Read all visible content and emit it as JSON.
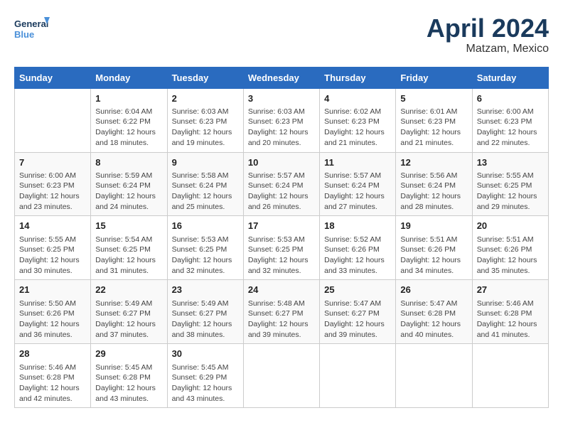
{
  "header": {
    "logo_line1": "General",
    "logo_line2": "Blue",
    "month_year": "April 2024",
    "location": "Matzam, Mexico"
  },
  "days_of_week": [
    "Sunday",
    "Monday",
    "Tuesday",
    "Wednesday",
    "Thursday",
    "Friday",
    "Saturday"
  ],
  "weeks": [
    [
      {
        "day": "",
        "info": ""
      },
      {
        "day": "1",
        "info": "Sunrise: 6:04 AM\nSunset: 6:22 PM\nDaylight: 12 hours\nand 18 minutes."
      },
      {
        "day": "2",
        "info": "Sunrise: 6:03 AM\nSunset: 6:23 PM\nDaylight: 12 hours\nand 19 minutes."
      },
      {
        "day": "3",
        "info": "Sunrise: 6:03 AM\nSunset: 6:23 PM\nDaylight: 12 hours\nand 20 minutes."
      },
      {
        "day": "4",
        "info": "Sunrise: 6:02 AM\nSunset: 6:23 PM\nDaylight: 12 hours\nand 21 minutes."
      },
      {
        "day": "5",
        "info": "Sunrise: 6:01 AM\nSunset: 6:23 PM\nDaylight: 12 hours\nand 21 minutes."
      },
      {
        "day": "6",
        "info": "Sunrise: 6:00 AM\nSunset: 6:23 PM\nDaylight: 12 hours\nand 22 minutes."
      }
    ],
    [
      {
        "day": "7",
        "info": "Sunrise: 6:00 AM\nSunset: 6:23 PM\nDaylight: 12 hours\nand 23 minutes."
      },
      {
        "day": "8",
        "info": "Sunrise: 5:59 AM\nSunset: 6:24 PM\nDaylight: 12 hours\nand 24 minutes."
      },
      {
        "day": "9",
        "info": "Sunrise: 5:58 AM\nSunset: 6:24 PM\nDaylight: 12 hours\nand 25 minutes."
      },
      {
        "day": "10",
        "info": "Sunrise: 5:57 AM\nSunset: 6:24 PM\nDaylight: 12 hours\nand 26 minutes."
      },
      {
        "day": "11",
        "info": "Sunrise: 5:57 AM\nSunset: 6:24 PM\nDaylight: 12 hours\nand 27 minutes."
      },
      {
        "day": "12",
        "info": "Sunrise: 5:56 AM\nSunset: 6:24 PM\nDaylight: 12 hours\nand 28 minutes."
      },
      {
        "day": "13",
        "info": "Sunrise: 5:55 AM\nSunset: 6:25 PM\nDaylight: 12 hours\nand 29 minutes."
      }
    ],
    [
      {
        "day": "14",
        "info": "Sunrise: 5:55 AM\nSunset: 6:25 PM\nDaylight: 12 hours\nand 30 minutes."
      },
      {
        "day": "15",
        "info": "Sunrise: 5:54 AM\nSunset: 6:25 PM\nDaylight: 12 hours\nand 31 minutes."
      },
      {
        "day": "16",
        "info": "Sunrise: 5:53 AM\nSunset: 6:25 PM\nDaylight: 12 hours\nand 32 minutes."
      },
      {
        "day": "17",
        "info": "Sunrise: 5:53 AM\nSunset: 6:25 PM\nDaylight: 12 hours\nand 32 minutes."
      },
      {
        "day": "18",
        "info": "Sunrise: 5:52 AM\nSunset: 6:26 PM\nDaylight: 12 hours\nand 33 minutes."
      },
      {
        "day": "19",
        "info": "Sunrise: 5:51 AM\nSunset: 6:26 PM\nDaylight: 12 hours\nand 34 minutes."
      },
      {
        "day": "20",
        "info": "Sunrise: 5:51 AM\nSunset: 6:26 PM\nDaylight: 12 hours\nand 35 minutes."
      }
    ],
    [
      {
        "day": "21",
        "info": "Sunrise: 5:50 AM\nSunset: 6:26 PM\nDaylight: 12 hours\nand 36 minutes."
      },
      {
        "day": "22",
        "info": "Sunrise: 5:49 AM\nSunset: 6:27 PM\nDaylight: 12 hours\nand 37 minutes."
      },
      {
        "day": "23",
        "info": "Sunrise: 5:49 AM\nSunset: 6:27 PM\nDaylight: 12 hours\nand 38 minutes."
      },
      {
        "day": "24",
        "info": "Sunrise: 5:48 AM\nSunset: 6:27 PM\nDaylight: 12 hours\nand 39 minutes."
      },
      {
        "day": "25",
        "info": "Sunrise: 5:47 AM\nSunset: 6:27 PM\nDaylight: 12 hours\nand 39 minutes."
      },
      {
        "day": "26",
        "info": "Sunrise: 5:47 AM\nSunset: 6:28 PM\nDaylight: 12 hours\nand 40 minutes."
      },
      {
        "day": "27",
        "info": "Sunrise: 5:46 AM\nSunset: 6:28 PM\nDaylight: 12 hours\nand 41 minutes."
      }
    ],
    [
      {
        "day": "28",
        "info": "Sunrise: 5:46 AM\nSunset: 6:28 PM\nDaylight: 12 hours\nand 42 minutes."
      },
      {
        "day": "29",
        "info": "Sunrise: 5:45 AM\nSunset: 6:28 PM\nDaylight: 12 hours\nand 43 minutes."
      },
      {
        "day": "30",
        "info": "Sunrise: 5:45 AM\nSunset: 6:29 PM\nDaylight: 12 hours\nand 43 minutes."
      },
      {
        "day": "",
        "info": ""
      },
      {
        "day": "",
        "info": ""
      },
      {
        "day": "",
        "info": ""
      },
      {
        "day": "",
        "info": ""
      }
    ]
  ]
}
